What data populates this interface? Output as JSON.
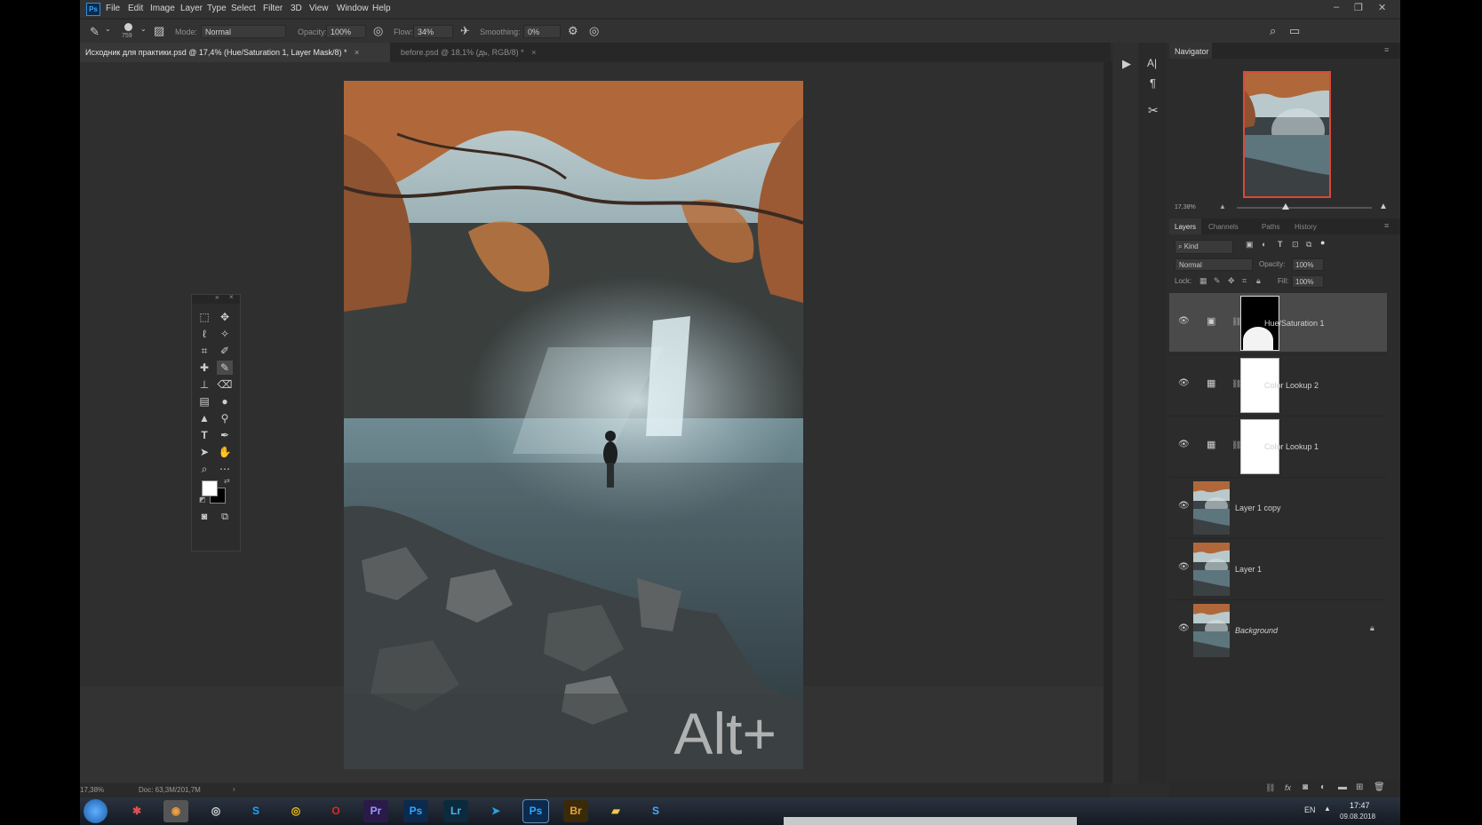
{
  "menubar": {
    "app_icon": "photoshop-app-icon",
    "items": [
      "File",
      "Edit",
      "Image",
      "Layer",
      "Type",
      "Select",
      "Filter",
      "3D",
      "View",
      "Window",
      "Help"
    ]
  },
  "options_bar": {
    "brush_size": "759",
    "mode_label": "Mode:",
    "mode_value": "Normal",
    "opacity_label": "Opacity:",
    "opacity_value": "100%",
    "flow_label": "Flow:",
    "flow_value": "34%",
    "smoothing_label": "Smoothing:",
    "smoothing_value": "0%"
  },
  "tabs": [
    {
      "label": "Исходник для практики.psd @ 17,4% (Hue/Saturation 1, Layer Mask/8) *",
      "active": true
    },
    {
      "label": "before.psd @ 18,1% (дь, RGB/8) *",
      "active": false
    }
  ],
  "canvas": {
    "overlay_text": "Alt+"
  },
  "status": {
    "zoom": "17,38%",
    "doc": "Doc: 63,3M/201,7M"
  },
  "navigator": {
    "title": "Navigator",
    "zoom": "17,38%",
    "slider_level": 0.36
  },
  "layers_panel": {
    "tabs": [
      "Layers",
      "Channels",
      "Paths",
      "History"
    ],
    "filter_kind": "Kind",
    "blend_mode": "Normal",
    "opacity_label": "Opacity:",
    "opacity_value": "100%",
    "lock_label": "Lock:",
    "fill_label": "Fill:",
    "fill_value": "100%",
    "layers": [
      {
        "name": "Hue/Saturation 1",
        "type": "adjustment",
        "selected": true
      },
      {
        "name": "Color Lookup 2",
        "type": "adjustment",
        "selected": false
      },
      {
        "name": "Color Lookup 1",
        "type": "adjustment",
        "selected": false
      },
      {
        "name": "Layer 1 copy",
        "type": "pixel",
        "selected": false
      },
      {
        "name": "Layer 1",
        "type": "pixel",
        "selected": false
      },
      {
        "name": "Background",
        "type": "background",
        "selected": false
      }
    ]
  },
  "taskbar": {
    "apps": [
      {
        "label": "Pr",
        "color": "#2a1a4a",
        "text_color": "#9999ff"
      },
      {
        "label": "Ps",
        "color": "#0b2a4e",
        "text_color": "#31a8ff"
      },
      {
        "label": "Lr",
        "color": "#0b2a3e",
        "text_color": "#4fb3e8"
      },
      {
        "label": "Ps",
        "color": "#0b2a4e",
        "text_color": "#31a8ff"
      },
      {
        "label": "Br",
        "color": "#3a2a0a",
        "text_color": "#e8a23a"
      }
    ],
    "language": "EN",
    "time": "17:47",
    "date": "09.08.2018"
  },
  "colors": {
    "accent_red": "#d9483b",
    "photoshop_blue": "#31a8ff"
  }
}
